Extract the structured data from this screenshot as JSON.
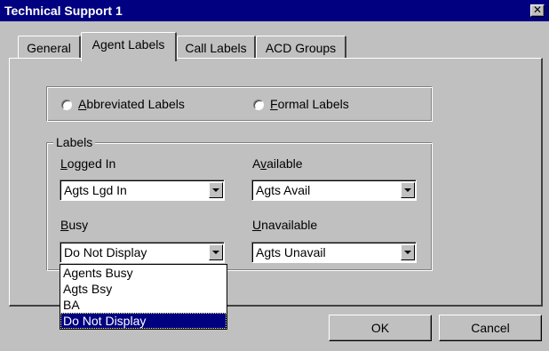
{
  "window": {
    "title": "Technical Support 1",
    "close_glyph": "✕"
  },
  "tabs": [
    {
      "label": "General",
      "active": false
    },
    {
      "label": "Agent Labels",
      "active": true
    },
    {
      "label": "Call Labels",
      "active": false
    },
    {
      "label": "ACD Groups",
      "active": false
    }
  ],
  "label_style": {
    "options": [
      {
        "mnemonic": "A",
        "rest": "bbreviated Labels",
        "selected": false
      },
      {
        "mnemonic": "F",
        "rest": "ormal Labels",
        "selected": false
      }
    ]
  },
  "labels_group": {
    "title": "Labels",
    "fields": [
      {
        "pre": "",
        "mnemonic": "L",
        "rest": "ogged In",
        "value": "Agts Lgd In"
      },
      {
        "pre": "A",
        "mnemonic": "v",
        "rest": "ailable",
        "value": "Agts Avail"
      },
      {
        "pre": "",
        "mnemonic": "B",
        "rest": "usy",
        "value": "Do Not Display"
      },
      {
        "pre": "",
        "mnemonic": "U",
        "rest": "navailable",
        "value": "Agts Unavail"
      }
    ]
  },
  "busy_dropdown": {
    "options": [
      "Agents Busy",
      "Agts Bsy",
      "BA",
      "Do Not Display"
    ],
    "selected": "Do Not Display"
  },
  "buttons": {
    "ok": "OK",
    "cancel": "Cancel"
  }
}
